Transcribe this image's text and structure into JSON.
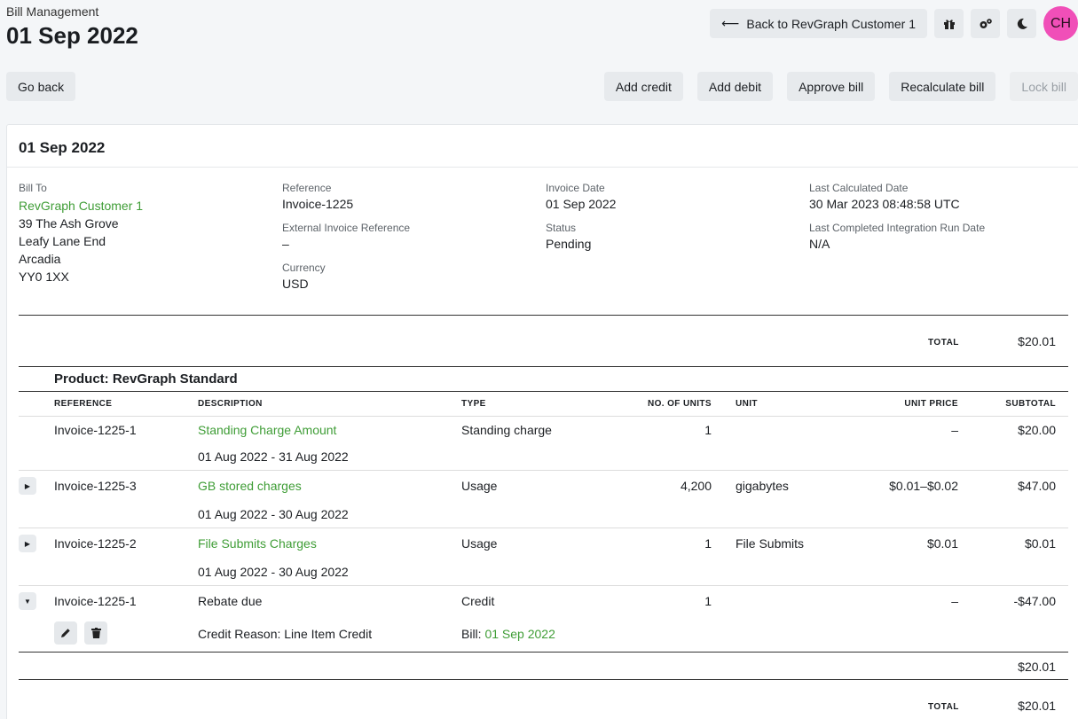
{
  "header": {
    "breadcrumb": "Bill Management",
    "title": "01 Sep 2022",
    "back_customer_label": "Back to RevGraph Customer 1",
    "avatar_initials": "CH"
  },
  "toolbar": {
    "go_back": "Go back",
    "add_credit": "Add credit",
    "add_debit": "Add debit",
    "approve_bill": "Approve bill",
    "recalculate_bill": "Recalculate bill",
    "lock_bill": "Lock bill"
  },
  "bill": {
    "title": "01 Sep 2022",
    "bill_to_label": "Bill To",
    "customer_name": "RevGraph Customer 1",
    "address": [
      "39 The Ash Grove",
      "Leafy Lane End",
      "Arcadia",
      "YY0 1XX"
    ],
    "reference_label": "Reference",
    "reference": "Invoice-1225",
    "external_ref_label": "External Invoice Reference",
    "external_ref": "–",
    "currency_label": "Currency",
    "currency": "USD",
    "invoice_date_label": "Invoice Date",
    "invoice_date": "01 Sep 2022",
    "status_label": "Status",
    "status": "Pending",
    "last_calc_label": "Last Calculated Date",
    "last_calc": "30 Mar 2023 08:48:58 UTC",
    "last_integration_label": "Last Completed Integration Run Date",
    "last_integration": "N/A",
    "total_label": "TOTAL",
    "total_top": "$20.01",
    "product_total": "$20.01",
    "total_bottom": "$20.01"
  },
  "product": {
    "title": "Product: RevGraph Standard",
    "columns": {
      "reference": "REFERENCE",
      "description": "DESCRIPTION",
      "type": "TYPE",
      "units": "NO. OF UNITS",
      "unit": "UNIT",
      "unit_price": "UNIT PRICE",
      "subtotal": "SUBTOTAL"
    },
    "rows": [
      {
        "reference": "Invoice-1225-1",
        "description": "Standing Charge Amount",
        "period": "01 Aug 2022 - 31 Aug 2022",
        "type": "Standing charge",
        "units": "1",
        "unit": "",
        "unit_price": "–",
        "subtotal": "$20.00"
      },
      {
        "reference": "Invoice-1225-3",
        "description": "GB stored charges",
        "period": "01 Aug 2022 - 30 Aug 2022",
        "type": "Usage",
        "units": "4,200",
        "unit": "gigabytes",
        "unit_price": "$0.01–$0.02",
        "subtotal": "$47.00"
      },
      {
        "reference": "Invoice-1225-2",
        "description": "File Submits Charges",
        "period": "01 Aug 2022 - 30 Aug 2022",
        "type": "Usage",
        "units": "1",
        "unit": "File Submits",
        "unit_price": "$0.01",
        "subtotal": "$0.01"
      },
      {
        "reference": "Invoice-1225-1",
        "description": "Rebate due",
        "credit_reason": "Credit Reason: Line Item Credit",
        "bill_prefix": "Bill: ",
        "bill_link": "01 Sep 2022",
        "type": "Credit",
        "units": "1",
        "unit": "",
        "unit_price": "–",
        "subtotal": "-$47.00"
      }
    ]
  },
  "icons": {
    "gift": "gift-icon",
    "settings": "gears-icon",
    "theme": "moon-icon",
    "edit": "pencil-icon",
    "delete": "trash-icon"
  },
  "colors": {
    "link": "#3f9d36",
    "avatar": "#f04fb8"
  }
}
